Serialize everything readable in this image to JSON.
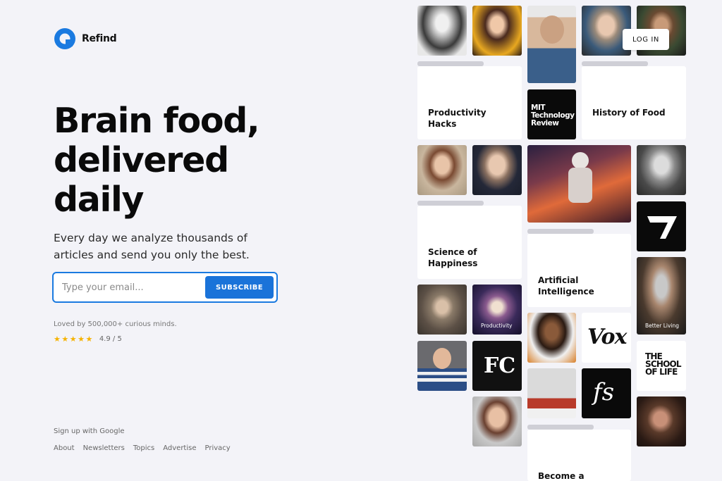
{
  "brand": {
    "name": "Refind",
    "accent": "#1a7ae0"
  },
  "hero": {
    "headline": "Brain food, delivered daily",
    "subtitle": "Every day we analyze thousands of articles and send you only the best."
  },
  "signup": {
    "placeholder": "Type your email...",
    "button_label": "SUBSCRIBE"
  },
  "social_proof": {
    "text": "Loved by 500,000+ curious minds.",
    "stars": "★★★★★",
    "rating": "4.9 / 5"
  },
  "google_signup": "Sign up with Google",
  "footer_links": [
    "About",
    "Newsletters",
    "Topics",
    "Advertise",
    "Privacy"
  ],
  "header": {
    "login_label": "LOG IN"
  },
  "topic_cards": [
    "Productivity Hacks",
    "History of Food",
    "Science of Happiness",
    "Artificial Intelligence",
    "Become a"
  ],
  "source_tiles": {
    "mit": "MIT Technology Review",
    "fc": "FC",
    "vox": "Vox",
    "fs": "fs",
    "school": "THE SCHOOL OF LIFE"
  },
  "photo_captions": {
    "productivity": "Productivity",
    "better_living": "Better Living"
  }
}
